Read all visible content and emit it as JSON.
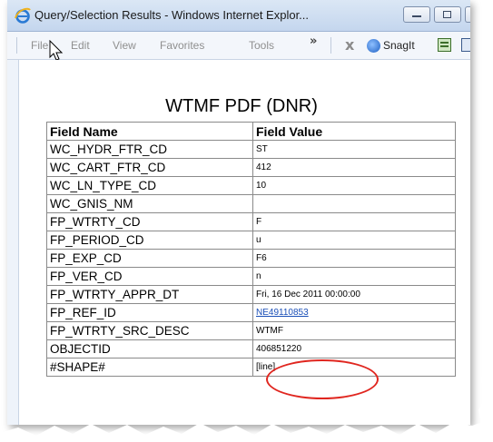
{
  "window": {
    "title": "Query/Selection Results - Windows Internet Explor...",
    "min_label": "",
    "max_label": ""
  },
  "menu": {
    "items": [
      "File",
      "Edit",
      "View",
      "Favorites",
      "Tools"
    ],
    "overflow": "»",
    "close_x": "x",
    "snagit": "SnagIt"
  },
  "page": {
    "title": "WTMF PDF (DNR)",
    "headers": [
      "Field Name",
      "Field Value"
    ],
    "rows": [
      {
        "name": "WC_HYDR_FTR_CD",
        "value": "ST"
      },
      {
        "name": "WC_CART_FTR_CD",
        "value": "412"
      },
      {
        "name": "WC_LN_TYPE_CD",
        "value": "10"
      },
      {
        "name": "WC_GNIS_NM",
        "value": ""
      },
      {
        "name": "FP_WTRTY_CD",
        "value": "F"
      },
      {
        "name": "FP_PERIOD_CD",
        "value": "u"
      },
      {
        "name": "FP_EXP_CD",
        "value": "F6"
      },
      {
        "name": "FP_VER_CD",
        "value": "n"
      },
      {
        "name": "FP_WTRTY_APPR_DT",
        "value": "Fri, 16 Dec 2011 00:00:00"
      },
      {
        "name": "FP_REF_ID",
        "value": "NE49110853",
        "link": true
      },
      {
        "name": "FP_WTRTY_SRC_DESC",
        "value": "WTMF"
      },
      {
        "name": "OBJECTID",
        "value": "406851220"
      },
      {
        "name": "#SHAPE#",
        "value": "[line]"
      }
    ]
  },
  "colors": {
    "annotation": "#e0261f",
    "link": "#1a4fb8"
  },
  "icons": [
    "ie-icon",
    "minimize-icon",
    "maximize-icon",
    "cursor-icon",
    "chevron-icon",
    "close-x-icon",
    "snagit-icon",
    "toolbar-icon"
  ]
}
